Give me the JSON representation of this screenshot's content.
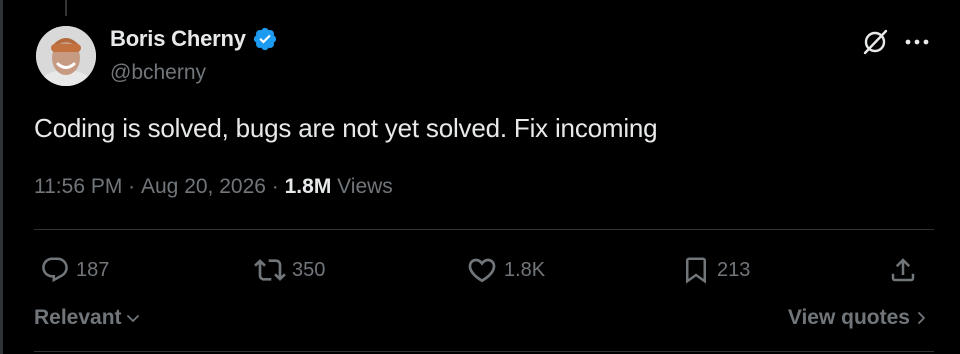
{
  "author": {
    "display_name": "Boris Cherny",
    "handle": "@bcherny",
    "verified": true,
    "verified_color": "#1d9bf0"
  },
  "tweet": {
    "text": "Coding is solved, bugs are not yet solved. Fix incoming",
    "time": "11:56 PM",
    "separator": " · ",
    "date": "Aug 20, 2026",
    "views_count": "1.8M",
    "views_label": " Views"
  },
  "actions": {
    "replies": "187",
    "reposts": "350",
    "likes": "1.8K",
    "bookmarks": "213"
  },
  "footer": {
    "sort_label": "Relevant",
    "view_quotes_label": "View quotes"
  },
  "icons": {
    "header": [
      "grok-icon",
      "more-icon"
    ],
    "actions": [
      "reply-icon",
      "repost-icon",
      "like-icon",
      "bookmark-icon",
      "share-icon"
    ],
    "footer": [
      "chevron-down-icon",
      "chevron-right-icon"
    ]
  },
  "colors": {
    "background": "#000000",
    "primary_text": "#e7e9ea",
    "secondary_text": "#71767b",
    "divider": "#2f3336"
  }
}
